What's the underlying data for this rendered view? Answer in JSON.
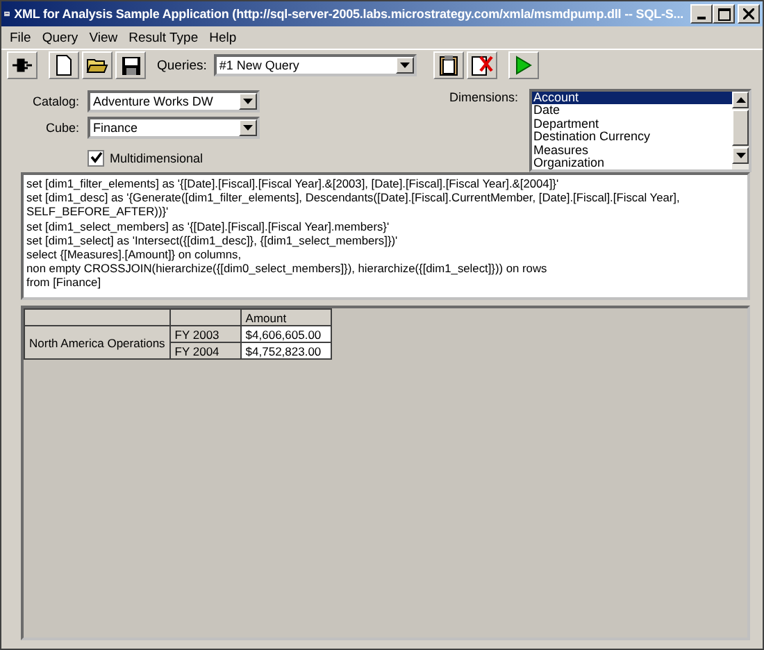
{
  "window": {
    "title": "XML for Analysis Sample Application (http://sql-server-2005.labs.microstrategy.com/xmla/msmdpump.dll -- SQL-S..."
  },
  "menu": [
    "File",
    "Query",
    "View",
    "Result Type",
    "Help"
  ],
  "toolbar": {
    "queries_label": "Queries:",
    "query": "#1 New Query"
  },
  "catalog": {
    "label": "Catalog:",
    "value": "Adventure Works DW"
  },
  "cube": {
    "label": "Cube:",
    "value": "Finance"
  },
  "multidimensional": {
    "label": "Multidimensional",
    "checked": true
  },
  "dimensions": {
    "label": "Dimensions:",
    "items": [
      {
        "label": "Account",
        "selected": true
      },
      {
        "label": "Date",
        "selected": false
      },
      {
        "label": "Department",
        "selected": false
      },
      {
        "label": "Destination Currency",
        "selected": false
      },
      {
        "label": "Measures",
        "selected": false
      },
      {
        "label": "Organization",
        "selected": false
      }
    ]
  },
  "query_lines": [
    "set [dim1_filter_elements] as '{[Date].[Fiscal].[Fiscal Year].&[2003], [Date].[Fiscal].[Fiscal Year].&[2004]}'",
    "set [dim1_desc] as '{Generate([dim1_filter_elements], Descendants([Date].[Fiscal].CurrentMember, [Date].[Fiscal].[Fiscal Year],",
    "SELF_BEFORE_AFTER))}'",
    "set [dim1_select_members] as '{[Date].[Fiscal].[Fiscal Year].members}'",
    "set [dim1_select] as 'Intersect({[dim1_desc]}, {[dim1_select_members]})'",
    "select {[Measures].[Amount]} on columns,",
    "non empty CROSSJOIN(hierarchize({[dim0_select_members]}), hierarchize({[dim1_select]})) on rows",
    "from [Finance]"
  ],
  "results": {
    "column_header": "Amount",
    "row_header": "North America Operations",
    "rows": [
      {
        "label": "FY 2003",
        "amount": "$4,606,605.00"
      },
      {
        "label": "FY 2004",
        "amount": "$4,752,823.00"
      }
    ]
  }
}
